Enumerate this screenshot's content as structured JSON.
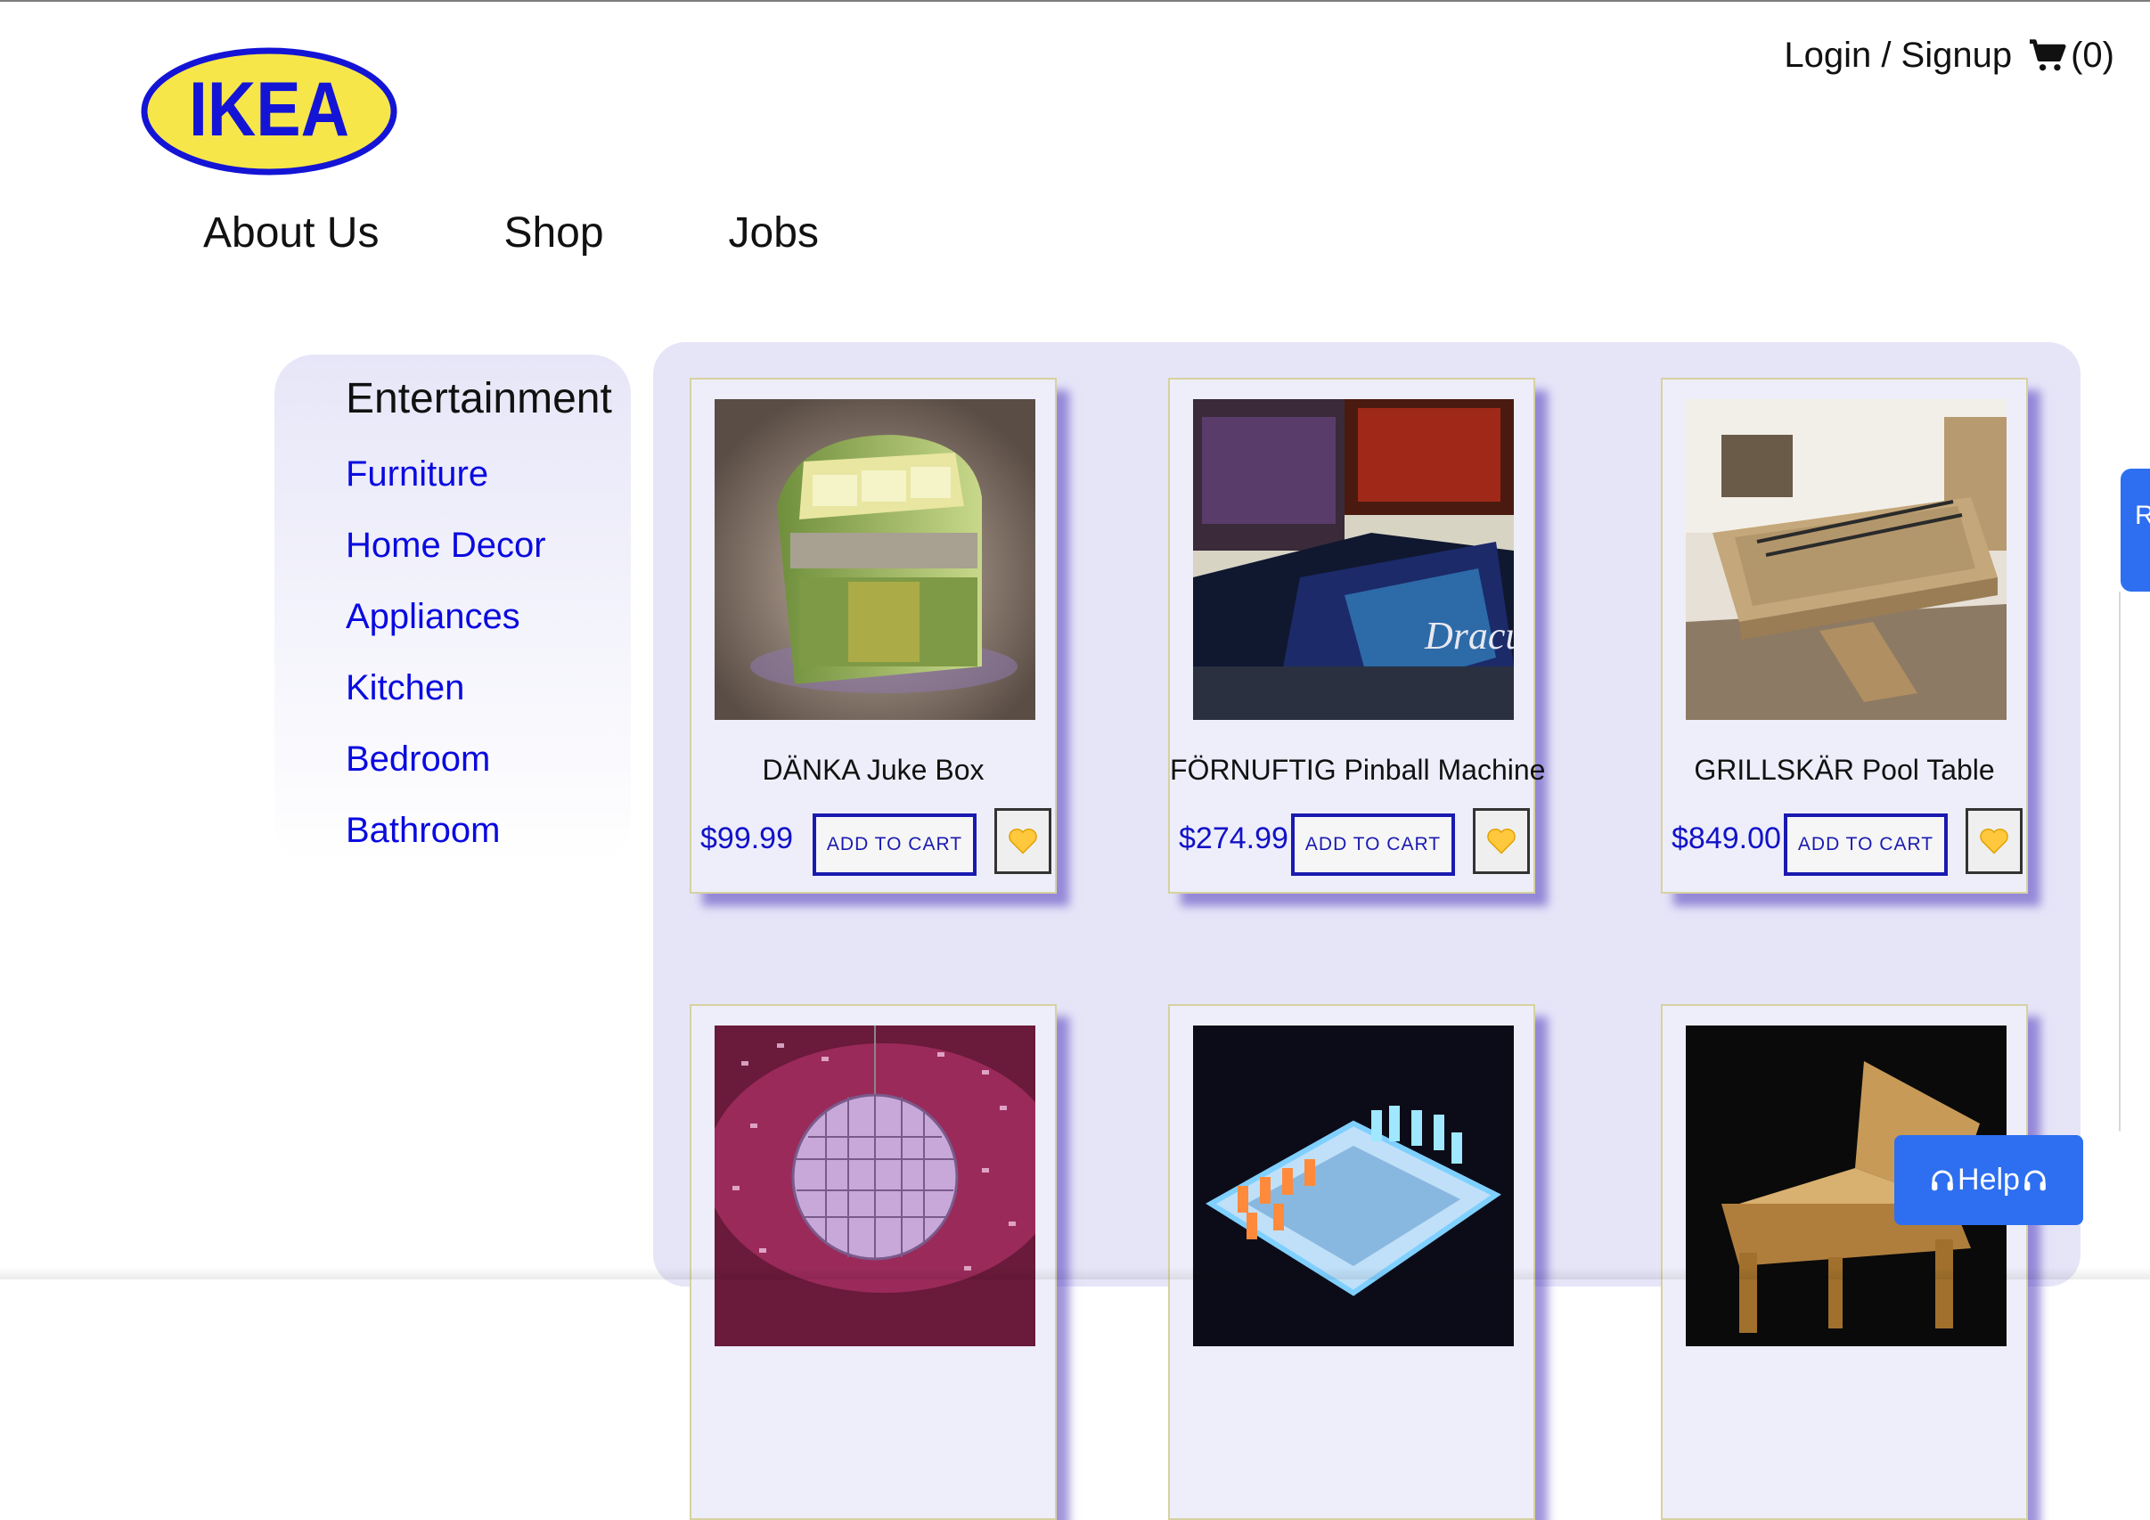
{
  "header": {
    "logo_text": "IKEA",
    "login_label": "Login / Signup",
    "cart_count": "(0)"
  },
  "nav": [
    "About Us",
    "Shop",
    "Jobs"
  ],
  "sidebar": {
    "title": "Entertainment",
    "items": [
      "Furniture",
      "Home Decor",
      "Appliances",
      "Kitchen",
      "Bedroom",
      "Bathroom"
    ]
  },
  "products": [
    {
      "name": "DÄNKA Juke Box",
      "price": "$99.99",
      "add_label": "ADD TO CART",
      "image": "jukebox"
    },
    {
      "name": "FÖRNUFTIG Pinball Machine",
      "price": "$274.99",
      "add_label": "ADD TO CART",
      "image": "pinball"
    },
    {
      "name": "GRILLSKÄR Pool Table",
      "price": "$849.00",
      "add_label": "ADD TO CART",
      "image": "pool-table"
    },
    {
      "name": "",
      "price": "",
      "add_label": "",
      "image": "disco-ball"
    },
    {
      "name": "",
      "price": "",
      "add_label": "",
      "image": "chess-board"
    },
    {
      "name": "",
      "price": "",
      "add_label": "",
      "image": "grand-piano"
    }
  ],
  "help": {
    "label": "Help"
  },
  "side_tab": {
    "label": "R"
  },
  "colors": {
    "link": "#0a0ae0",
    "accent": "#2d6ff0",
    "logo_yellow": "#f7e64a",
    "logo_blue": "#1414d6"
  }
}
